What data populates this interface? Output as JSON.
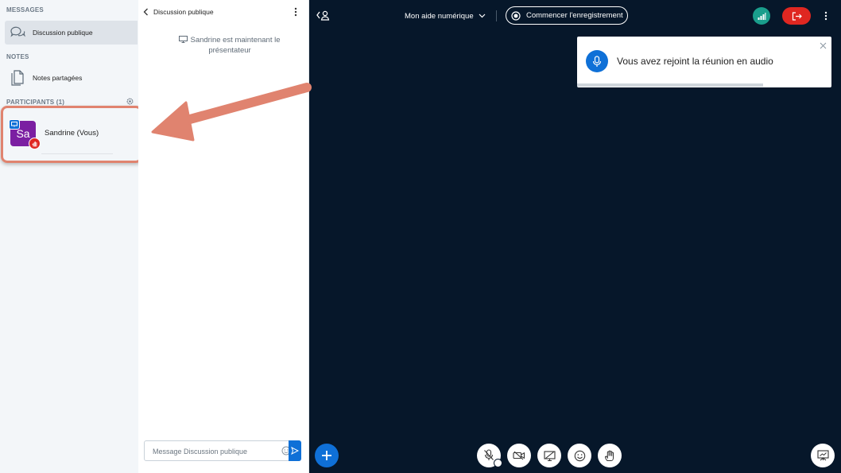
{
  "sidebar": {
    "messages_header": "MESSAGES",
    "public_chat_label": "Discussion publique",
    "notes_header": "NOTES",
    "shared_notes_label": "Notes partagées",
    "participants_header": "PARTICIPANTS (1)",
    "participant": {
      "initials": "Sa",
      "name": "Sandrine (Vous)",
      "avatar_color": "#7b1fa2"
    }
  },
  "chat": {
    "title": "Discussion publique",
    "system_message": "Sandrine est maintenant le présentateur",
    "input_placeholder": "Message Discussion publique"
  },
  "topbar": {
    "meeting_title": "Mon aide numérique",
    "record_label": "Commencer l'enregistrement"
  },
  "toast": {
    "message": "Vous avez rejoint la réunion en audio",
    "progress": 0.73
  },
  "colors": {
    "accent": "#0f70d7",
    "main_bg": "#06172a",
    "leave": "#df2721",
    "connection": "#1a9e8c",
    "highlight": "#e0836f"
  },
  "icons": [
    "chat-bubbles-icon",
    "notes-icon",
    "gear-icon",
    "presenter-icon",
    "raised-hand-icon",
    "chevron-left-icon",
    "kebab-menu-icon",
    "monitor-icon",
    "emoji-icon",
    "send-icon",
    "user-list-toggle-icon",
    "chevron-down-icon",
    "record-dot-icon",
    "signal-bars-icon",
    "leave-icon",
    "microphone-icon",
    "close-icon",
    "plus-icon",
    "muted-microphone-icon",
    "camera-off-icon",
    "screenshare-off-icon",
    "reaction-icon",
    "hand-icon",
    "presentation-icon"
  ]
}
